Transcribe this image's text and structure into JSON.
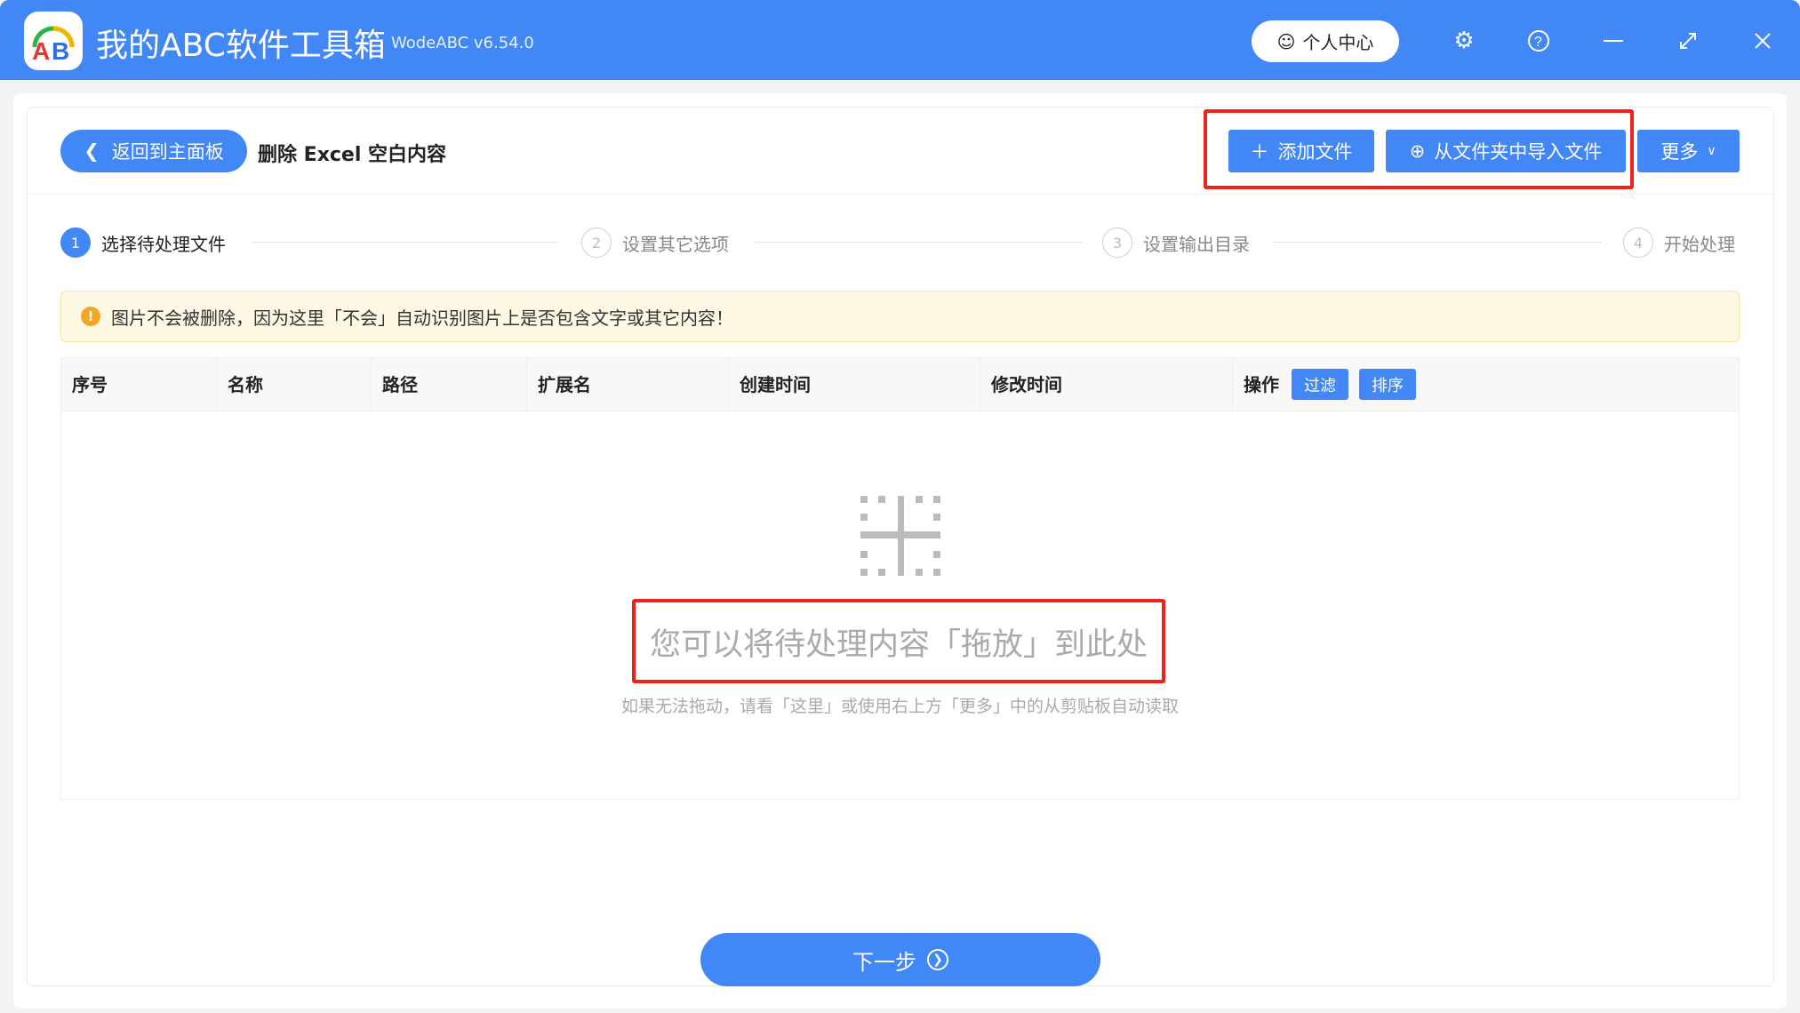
{
  "app": {
    "title": "我的ABC软件工具箱",
    "version": "WodeABC v6.54.0",
    "logo_text": "AB",
    "user_center": "个人中心"
  },
  "header": {
    "back": "返回到主面板",
    "page_title": "删除 Excel 空白内容",
    "add_file": "添加文件",
    "import_folder": "从文件夹中导入文件",
    "more": "更多"
  },
  "steps": [
    {
      "num": "1",
      "label": "选择待处理文件"
    },
    {
      "num": "2",
      "label": "设置其它选项"
    },
    {
      "num": "3",
      "label": "设置输出目录"
    },
    {
      "num": "4",
      "label": "开始处理"
    }
  ],
  "notice": "图片不会被删除，因为这里「不会」自动识别图片上是否包含文字或其它内容！",
  "table": {
    "columns": [
      "序号",
      "名称",
      "路径",
      "扩展名",
      "创建时间",
      "修改时间",
      "操作"
    ],
    "filter": "过滤",
    "sort": "排序"
  },
  "empty": {
    "title": "您可以将待处理内容「拖放」到此处",
    "hint": "如果无法拖动，请看「这里」或使用右上方「更多」中的从剪贴板自动读取"
  },
  "next": "下一步"
}
